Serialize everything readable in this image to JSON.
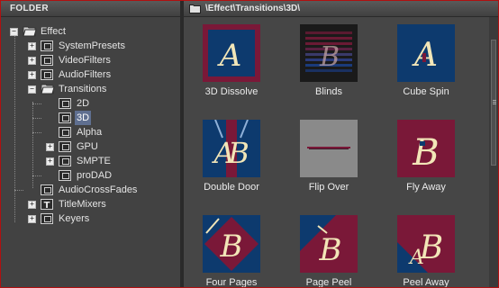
{
  "folder_panel": {
    "title": "FOLDER"
  },
  "tree": [
    {
      "label": "Effect",
      "icon": "folder-open-icon",
      "expander": "−",
      "depth": 0
    },
    {
      "label": "SystemPresets",
      "icon": "film-icon",
      "expander": "+",
      "depth": 1
    },
    {
      "label": "VideoFilters",
      "icon": "film-icon",
      "expander": "+",
      "depth": 1
    },
    {
      "label": "AudioFilters",
      "icon": "film-icon",
      "expander": "+",
      "depth": 1
    },
    {
      "label": "Transitions",
      "icon": "folder-open-icon",
      "expander": "−",
      "depth": 1
    },
    {
      "label": "2D",
      "icon": "film-icon",
      "expander": "",
      "depth": 2
    },
    {
      "label": "3D",
      "icon": "film-icon",
      "expander": "",
      "depth": 2,
      "selected": true
    },
    {
      "label": "Alpha",
      "icon": "film-icon",
      "expander": "",
      "depth": 2
    },
    {
      "label": "GPU",
      "icon": "film-icon",
      "expander": "+",
      "depth": 2
    },
    {
      "label": "SMPTE",
      "icon": "film-icon",
      "expander": "+",
      "depth": 2
    },
    {
      "label": "proDAD",
      "icon": "film-icon",
      "expander": "",
      "depth": 2
    },
    {
      "label": "AudioCrossFades",
      "icon": "film-icon",
      "expander": "",
      "depth": 1
    },
    {
      "label": "TitleMixers",
      "icon": "title-icon",
      "expander": "+",
      "depth": 1
    },
    {
      "label": "Keyers",
      "icon": "film-icon",
      "expander": "+",
      "depth": 1
    }
  ],
  "path_bar": {
    "path": "\\Effect\\Transitions\\3D\\"
  },
  "items": [
    {
      "label": "3D Dissolve",
      "icon": "dissolve-thumbnail"
    },
    {
      "label": "Blinds",
      "icon": "blinds-thumbnail"
    },
    {
      "label": "Cube Spin",
      "icon": "cube-spin-thumbnail"
    },
    {
      "label": "Double Door",
      "icon": "double-door-thumbnail"
    },
    {
      "label": "Flip Over",
      "icon": "flip-over-thumbnail"
    },
    {
      "label": "Fly Away",
      "icon": "fly-away-thumbnail"
    },
    {
      "label": "Four Pages",
      "icon": "four-pages-thumbnail"
    },
    {
      "label": "Page Peel",
      "icon": "page-peel-thumbnail"
    },
    {
      "label": "Peel Away",
      "icon": "peel-away-thumbnail"
    }
  ],
  "colors": {
    "navy": "#0d3a6e",
    "maroon": "#7a1838",
    "selection": "#5f6f90",
    "letter": "#f2e6b8"
  }
}
